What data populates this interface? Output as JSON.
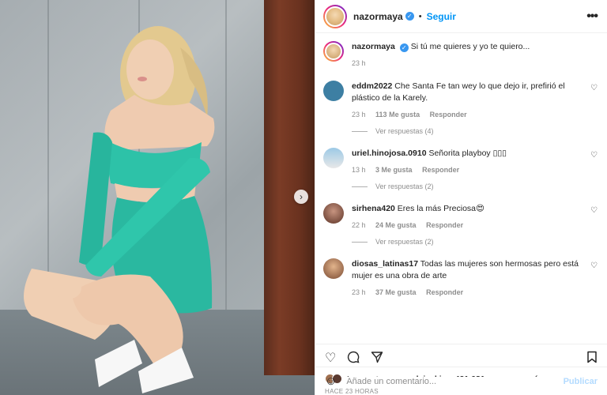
{
  "post": {
    "author": "nazormaya",
    "follow_label": "Seguir",
    "more_label": "•••",
    "next_label": "›"
  },
  "caption": {
    "user": "nazormaya",
    "text": "Si tú me quieres y yo te quiero...",
    "time": "23 h"
  },
  "comments": [
    {
      "user": "eddm2022",
      "text": "Che Santa Fe tan wey lo que dejo ir, prefirió el plástico de la Karely.",
      "time": "23 h",
      "likes": "113 Me gusta",
      "reply_label": "Responder",
      "view_replies": "Ver respuestas (4)",
      "avatar_color": "#3d7fa3"
    },
    {
      "user": "uriel.hinojosa.0910",
      "text": "Señorita playboy ▯▯▯",
      "time": "13 h",
      "likes": "3 Me gusta",
      "reply_label": "Responder",
      "view_replies": "Ver respuestas (2)",
      "avatar_color": "#6fa6c9"
    },
    {
      "user": "sirhena420",
      "text": "Eres la más Preciosa😍",
      "time": "22 h",
      "likes": "24 Me gusta",
      "reply_label": "Responder",
      "view_replies": "Ver respuestas (2)",
      "avatar_color": "#8a5a4a"
    },
    {
      "user": "diosas_latinas17",
      "text": "Todas las mujeres son hermosas pero está mujer es una obra de arte",
      "time": "23 h",
      "likes": "37 Me gusta",
      "reply_label": "Responder",
      "view_replies": "",
      "avatar_color": "#9c6b4e"
    }
  ],
  "likes": {
    "prefix": "Les gusta a",
    "user": "yosoylajackie",
    "connector": "y",
    "count": "421.681 personas más"
  },
  "time_ago": "HACE 23 HORAS",
  "add_comment": {
    "placeholder": "Añade un comentario...",
    "publish_label": "Publicar"
  },
  "icons": {
    "heart": "heart-icon",
    "comment": "comment-icon",
    "share": "share-icon",
    "save": "bookmark-icon",
    "emoji": "emoji-icon"
  },
  "colors": {
    "accent": "#0095f6",
    "dress": "#2dc2a8",
    "door": "#6a321f"
  }
}
